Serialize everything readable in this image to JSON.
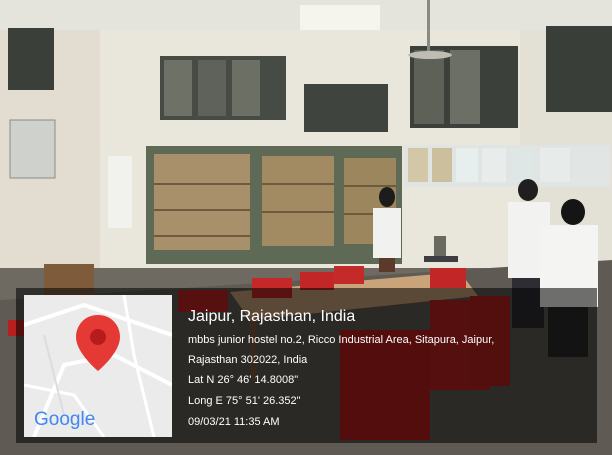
{
  "geotag": {
    "title": "Jaipur, Rajasthan, India",
    "address_line1": "mbbs junior hostel no.2, Ricco Industrial Area, Sitapura, Jaipur,",
    "address_line2": "Rajasthan 302022, India",
    "latitude": "Lat N 26° 46' 14.8008\"",
    "longitude": "Long E 75° 51' 26.352\"",
    "datetime": "09/03/21 11:35 AM"
  },
  "map": {
    "logo_text": "Google",
    "pin_color": "#e53935"
  }
}
